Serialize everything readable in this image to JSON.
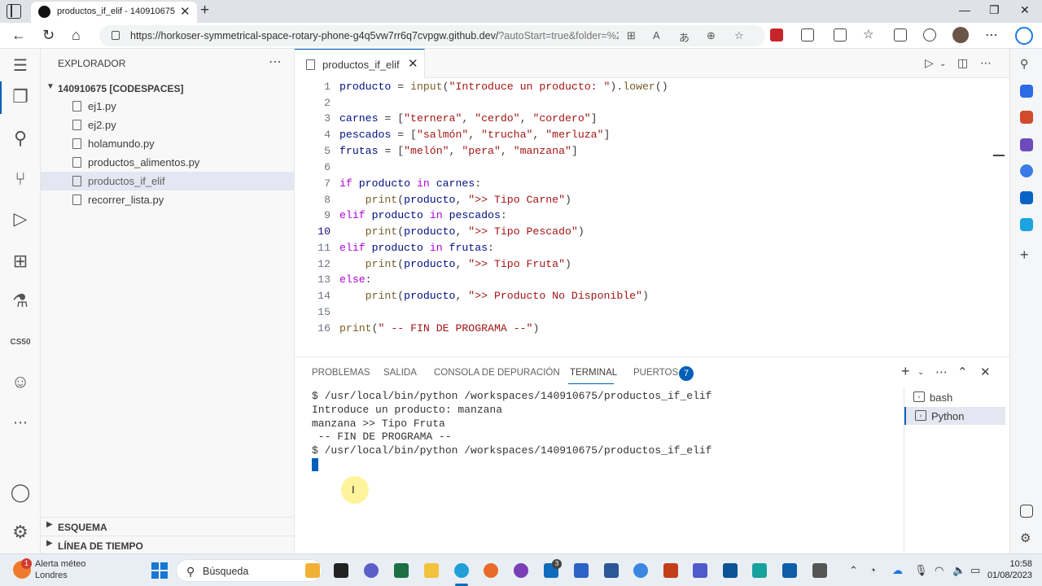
{
  "browser": {
    "tab_title": "productos_if_elif - 140910675 [C...",
    "url_main": "https://horkoser-symmetrical-space-rotary-phone-g4q5vw7rr6q7cvpgw.github.dev/",
    "url_rest": "?autoStart=true&folder=%2Fw..."
  },
  "explorer": {
    "title": "EXPLORADOR",
    "workspace": "140910675 [CODESPACES]",
    "files": [
      {
        "name": "ej1.py"
      },
      {
        "name": "ej2.py"
      },
      {
        "name": "holamundo.py"
      },
      {
        "name": "productos_alimentos.py"
      },
      {
        "name": "productos_if_elif"
      },
      {
        "name": "recorrer_lista.py"
      }
    ],
    "outline": "ESQUEMA",
    "timeline": "LÍNEA DE TIEMPO"
  },
  "activity": {
    "cs50_label": "CS50"
  },
  "editor": {
    "tab_name": "productos_if_elif",
    "line_numbers": [
      "1",
      "2",
      "3",
      "4",
      "5",
      "6",
      "7",
      "8",
      "9",
      "10",
      "11",
      "12",
      "13",
      "14",
      "15",
      "16"
    ]
  },
  "panel": {
    "tabs": [
      "PROBLEMAS",
      "SALIDA",
      "CONSOLA DE DEPURACIÓN",
      "TERMINAL",
      "PUERTOS"
    ],
    "ports_count": "7",
    "terminal_lines": [
      "$ /usr/local/bin/python /workspaces/140910675/productos_if_elif",
      "Introduce un producto: manzana",
      "manzana >> Tipo Fruta",
      " -- FIN DE PROGRAMA --",
      "$ /usr/local/bin/python /workspaces/140910675/productos_if_elif"
    ],
    "terminals": [
      "bash",
      "Python"
    ]
  },
  "taskbar": {
    "weather_line1": "Alerta méteo",
    "weather_line2": "Londres",
    "weather_badge": "1",
    "search_label": "Búsqueda",
    "mail_badge": "3",
    "time": "10:58",
    "date": "01/08/2023"
  }
}
